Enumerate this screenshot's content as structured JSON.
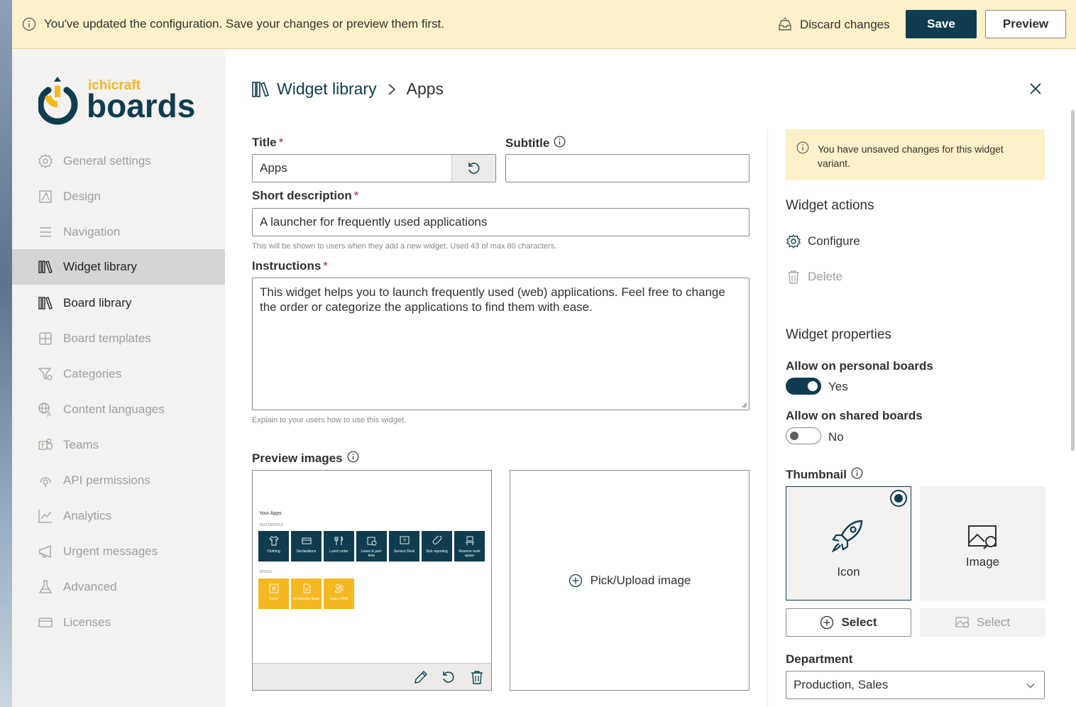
{
  "topbar": {
    "message": "You've updated the configuration. Save your changes or preview them first.",
    "discard_label": "Discard changes",
    "save_label": "Save",
    "preview_label": "Preview"
  },
  "logo": {
    "brand_small": "ichicraft",
    "brand_large": "boards"
  },
  "sidebar": {
    "items": [
      {
        "label": "General settings",
        "icon": "gear-icon"
      },
      {
        "label": "Design",
        "icon": "design-icon"
      },
      {
        "label": "Navigation",
        "icon": "navigation-icon"
      },
      {
        "label": "Widget library",
        "icon": "library-icon"
      },
      {
        "label": "Board library",
        "icon": "library-icon"
      },
      {
        "label": "Board templates",
        "icon": "template-icon"
      },
      {
        "label": "Categories",
        "icon": "filter-icon"
      },
      {
        "label": "Content languages",
        "icon": "globe-icon"
      },
      {
        "label": "Teams",
        "icon": "teams-icon"
      },
      {
        "label": "API permissions",
        "icon": "api-icon"
      },
      {
        "label": "Analytics",
        "icon": "chart-icon"
      },
      {
        "label": "Urgent messages",
        "icon": "megaphone-icon"
      },
      {
        "label": "Advanced",
        "icon": "flask-icon"
      },
      {
        "label": "Licenses",
        "icon": "card-icon"
      }
    ]
  },
  "breadcrumb": {
    "parent": "Widget library",
    "current": "Apps"
  },
  "form": {
    "title_label": "Title",
    "title_value": "Apps",
    "subtitle_label": "Subtitle",
    "subtitle_value": "",
    "short_desc_label": "Short description",
    "short_desc_value": "A launcher for frequently used applications",
    "short_desc_hint": "This will be shown to users when they add a new widget. Used 43 of max 80 characters.",
    "instructions_label": "Instructions",
    "instructions_value": "This widget helps you to launch frequently used (web) applications. Feel free to change the order or categorize the applications to find them with ease.",
    "instructions_hint": "Explain to your users how to use this widget.",
    "preview_images_label": "Preview images",
    "pick_upload_label": "Pick/Upload image",
    "required_mark": "*"
  },
  "preview_image": {
    "title": "Your Apps",
    "section1": "SELFSERVICE",
    "section2": "OFFICE",
    "tiles1": [
      "Clothing",
      "Declarations",
      "Lunch order",
      "Leave & part-time",
      "Service Desk",
      "Sick reporting",
      "Reserve work space"
    ],
    "tiles2": [
      "Excel",
      "Knowledge Base",
      "Sales CRM"
    ]
  },
  "right": {
    "warning": "You have unsaved changes for this widget variant.",
    "actions_heading": "Widget actions",
    "configure_label": "Configure",
    "delete_label": "Delete",
    "properties_heading": "Widget properties",
    "personal_label": "Allow on personal boards",
    "personal_value": "Yes",
    "shared_label": "Allow on shared boards",
    "shared_value": "No",
    "thumbnail_label": "Thumbnail",
    "thumb_icon_label": "Icon",
    "thumb_image_label": "Image",
    "select_label": "Select",
    "select_disabled_label": "Select",
    "department_label": "Department",
    "department_value": "Production, Sales"
  },
  "colors": {
    "brand": "#0f3d4f",
    "accent": "#f5b821",
    "banner": "#fdf1c9"
  }
}
